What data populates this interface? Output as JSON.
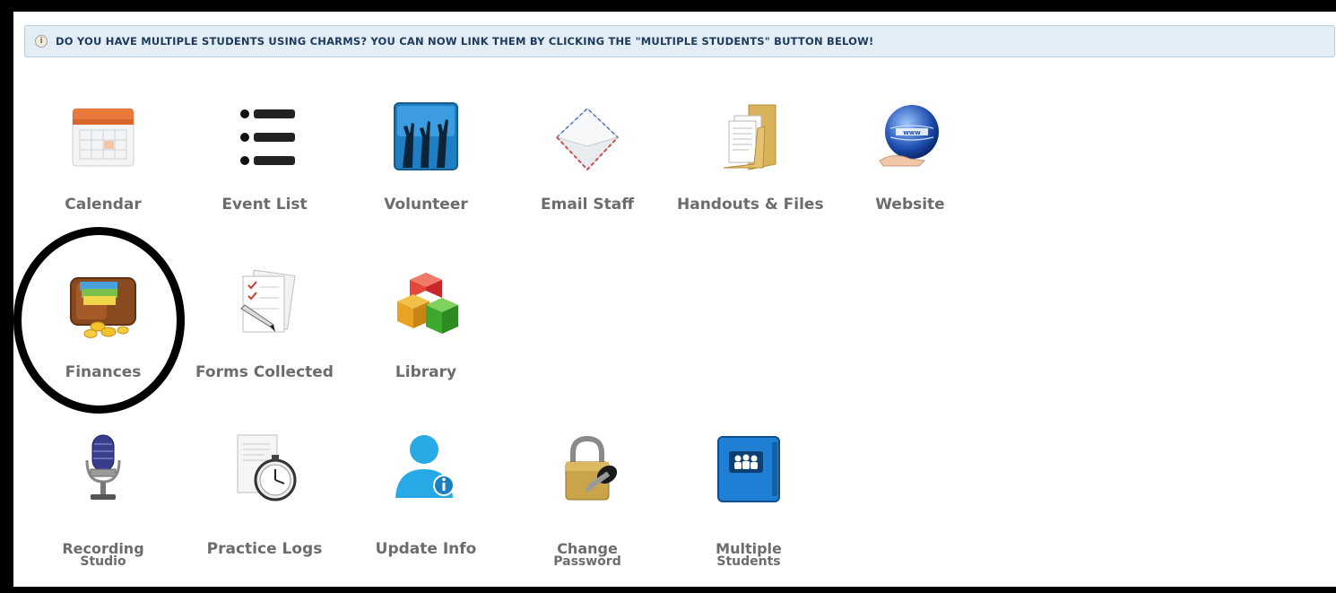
{
  "notice": {
    "text": "DO YOU HAVE MULTIPLE STUDENTS USING CHARMS? YOU CAN NOW LINK THEM BY CLICKING THE \"MULTIPLE STUDENTS\" BUTTON BELOW!",
    "icon": "info-icon"
  },
  "tiles": [
    {
      "label": "Calendar",
      "icon": "calendar-icon"
    },
    {
      "label": "Event List",
      "icon": "list-icon"
    },
    {
      "label": "Volunteer",
      "icon": "volunteer-hands-icon"
    },
    {
      "label": "Email Staff",
      "icon": "envelope-icon"
    },
    {
      "label": "Handouts & Files",
      "icon": "folder-icon"
    },
    {
      "label": "Website",
      "icon": "globe-icon"
    },
    {
      "label": "Finances",
      "icon": "wallet-icon"
    },
    {
      "label": "Forms Collected",
      "icon": "forms-icon"
    },
    {
      "label": "Library",
      "icon": "blocks-icon"
    },
    {
      "label_line1": "Recording",
      "label_line2": "Studio",
      "icon": "microphone-icon"
    },
    {
      "label": "Practice Logs",
      "icon": "stopwatch-icon"
    },
    {
      "label": "Update Info",
      "icon": "user-info-icon"
    },
    {
      "label_line1": "Change",
      "label_line2": "Password",
      "icon": "lock-key-icon"
    },
    {
      "label_line1": "Multiple",
      "label_line2": "Students",
      "icon": "students-icon"
    }
  ],
  "highlight": {
    "target": "Finances",
    "color": "#000000"
  }
}
